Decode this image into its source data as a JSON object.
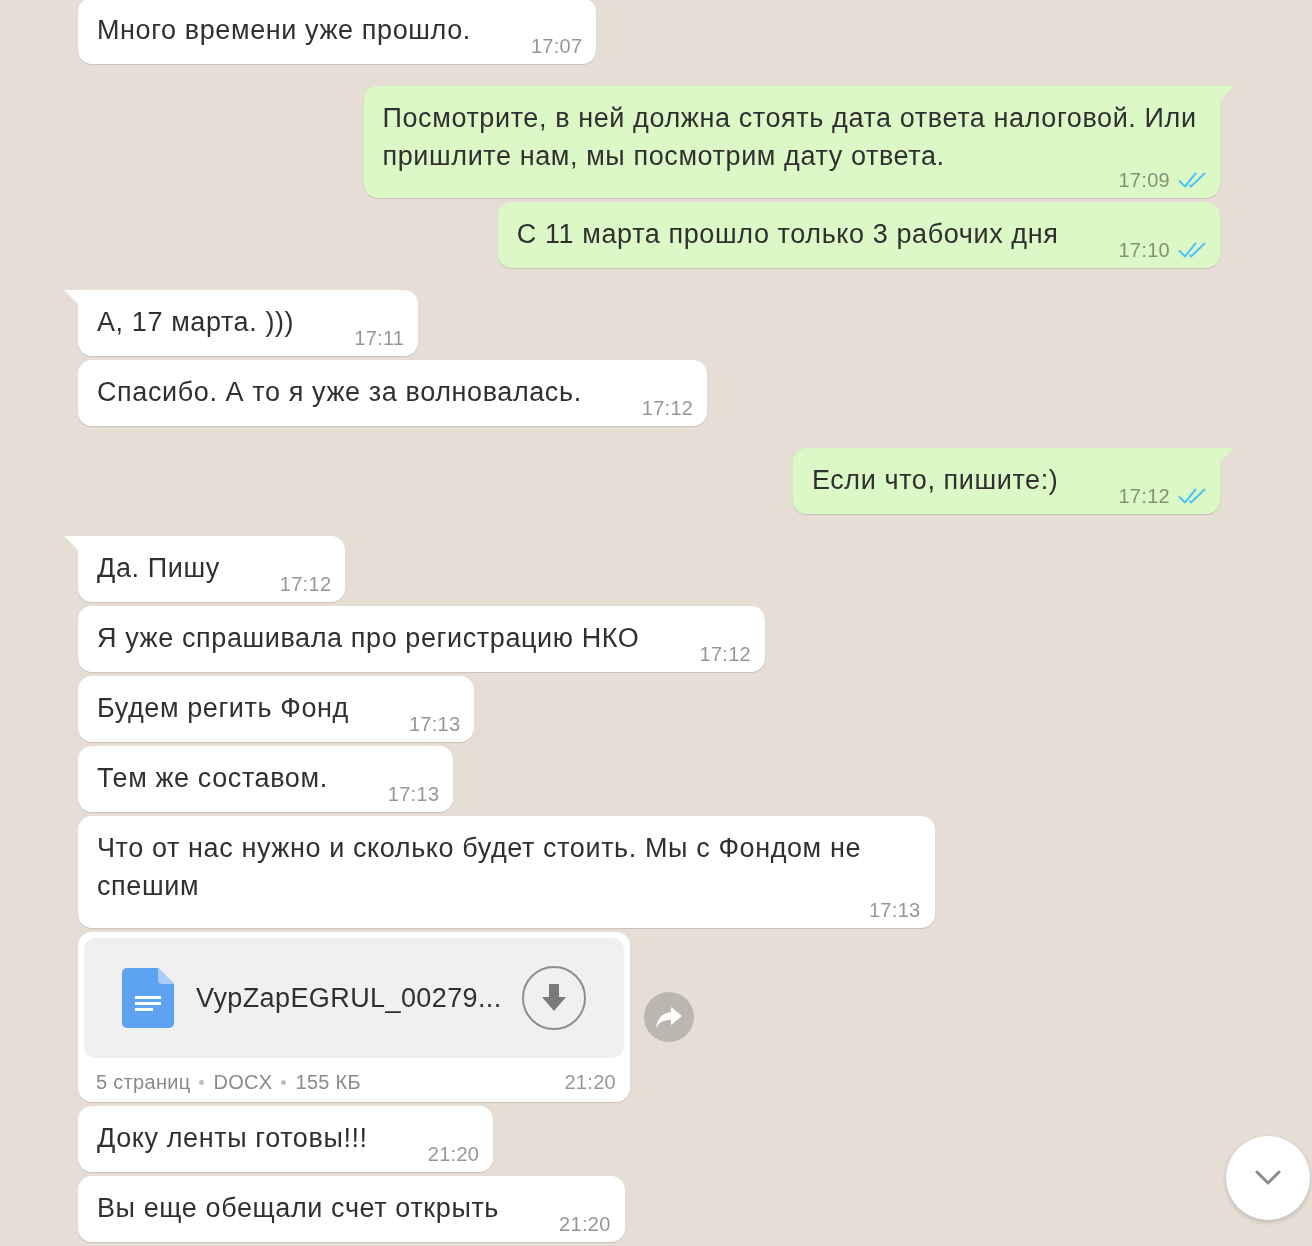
{
  "messages": [
    {
      "outgoing": false,
      "kind": "text",
      "text": "Много времени уже прошло.",
      "time": "17:07"
    },
    {
      "outgoing": true,
      "kind": "text",
      "text": "Посмотрите, в ней должна стоять дата ответа налоговой. Или пришлите нам, мы посмотрим дату ответа.",
      "time": "17:09",
      "read": true
    },
    {
      "outgoing": true,
      "kind": "text",
      "text": "С 11 марта прошло только 3 рабочих дня",
      "time": "17:10",
      "read": true
    },
    {
      "outgoing": false,
      "kind": "text",
      "text": "А, 17 марта. )))",
      "time": "17:11"
    },
    {
      "outgoing": false,
      "kind": "text",
      "text": "Спасибо. А то я уже за волновалась.",
      "time": "17:12"
    },
    {
      "outgoing": true,
      "kind": "text",
      "text": "Если что, пишите:)",
      "time": "17:12",
      "read": true
    },
    {
      "outgoing": false,
      "kind": "text",
      "text": "Да. Пишу",
      "time": "17:12"
    },
    {
      "outgoing": false,
      "kind": "text",
      "text": "Я уже спрашивала про регистрацию НКО",
      "time": "17:12"
    },
    {
      "outgoing": false,
      "kind": "text",
      "text": "Будем регить Фонд",
      "time": "17:13"
    },
    {
      "outgoing": false,
      "kind": "text",
      "text": "Тем же составом.",
      "time": "17:13"
    },
    {
      "outgoing": false,
      "kind": "text",
      "text": "Что от нас нужно и сколько будет стоить. Мы с Фондом не спешим",
      "time": "17:13"
    },
    {
      "outgoing": false,
      "kind": "document",
      "file_name": "VypZapEGRUL_00279...",
      "details": [
        "5 страниц",
        "DOCX",
        "155 КБ"
      ],
      "time": "21:20"
    },
    {
      "outgoing": false,
      "kind": "text",
      "text": "Доку ленты готовы!!!",
      "time": "21:20"
    },
    {
      "outgoing": false,
      "kind": "text",
      "text": "Вы еще обещали счет открыть",
      "time": "21:20"
    }
  ]
}
